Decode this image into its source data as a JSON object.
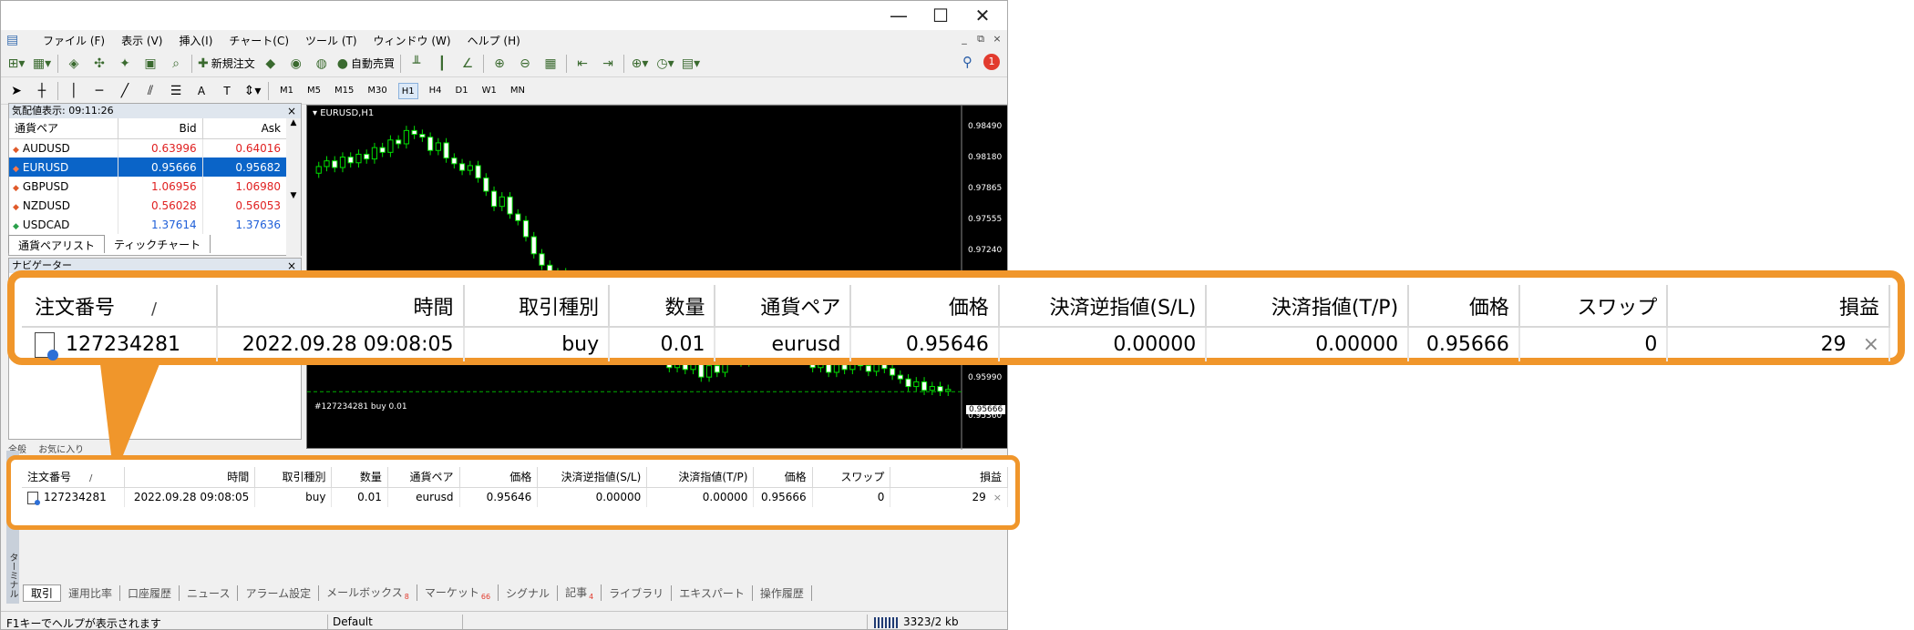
{
  "window": {
    "controls": {
      "minimize": "—",
      "maximize": "☐",
      "close": "✕"
    },
    "mdi_controls": [
      "_",
      "⧉",
      "×"
    ]
  },
  "menu": [
    "ファイル (F)",
    "表示 (V)",
    "挿入(I)",
    "チャート(C)",
    "ツール (T)",
    "ウィンドウ (W)",
    "ヘルプ (H)"
  ],
  "toolbar": {
    "new_order": "新規注文",
    "auto_trading": "自動売買",
    "notification_count": "1"
  },
  "timeframes": [
    "M1",
    "M5",
    "M15",
    "M30",
    "H1",
    "H4",
    "D1",
    "W1",
    "MN"
  ],
  "active_timeframe": "H1",
  "market_watch": {
    "title": "気配値表示: 09:11:26",
    "headers": {
      "symbol": "通貨ペア",
      "bid": "Bid",
      "ask": "Ask"
    },
    "rows": [
      {
        "symbol": "AUDUSD",
        "bid": "0.63996",
        "ask": "0.64016",
        "dir": "down"
      },
      {
        "symbol": "EURUSD",
        "bid": "0.95666",
        "ask": "0.95682",
        "dir": "down",
        "selected": true
      },
      {
        "symbol": "GBPUSD",
        "bid": "1.06956",
        "ask": "1.06980",
        "dir": "down"
      },
      {
        "symbol": "NZDUSD",
        "bid": "0.56028",
        "ask": "0.56053",
        "dir": "down"
      },
      {
        "symbol": "USDCAD",
        "bid": "1.37614",
        "ask": "1.37636",
        "dir": "up"
      }
    ],
    "tabs": [
      "通貨ペアリスト",
      "ティックチャート"
    ]
  },
  "navigator": {
    "title": "ナビゲーター"
  },
  "chart": {
    "title": "EURUSD,H1",
    "price_ticks": [
      "0.98490",
      "0.98180",
      "0.97865",
      "0.97555",
      "0.97240",
      "0.95990",
      "0.95360"
    ],
    "order_line_label": "#127234281 buy 0.01",
    "bid_tag": "0.95666",
    "candles": [
      0.9795,
      0.9802,
      0.9808,
      0.9801,
      0.9812,
      0.9806,
      0.9815,
      0.981,
      0.9822,
      0.9817,
      0.983,
      0.9826,
      0.984,
      0.9836,
      0.9833,
      0.9819,
      0.9827,
      0.9811,
      0.9805,
      0.9798,
      0.9803,
      0.979,
      0.9776,
      0.976,
      0.977,
      0.9752,
      0.9745,
      0.9728,
      0.971,
      0.9698,
      0.9684,
      0.969,
      0.967,
      0.966,
      0.9645,
      0.9655,
      0.9636,
      0.9628,
      0.964,
      0.9622,
      0.9605,
      0.9615,
      0.9598,
      0.961,
      0.9602,
      0.959,
      0.96,
      0.9588,
      0.9595,
      0.958,
      0.9592,
      0.9585,
      0.9598,
      0.9604,
      0.9596,
      0.961,
      0.9602,
      0.9615,
      0.9608,
      0.962,
      0.9611,
      0.9604,
      0.9598,
      0.959,
      0.9596,
      0.9585,
      0.9593,
      0.9588,
      0.96,
      0.9592,
      0.9586,
      0.9597,
      0.9589,
      0.9582,
      0.9578,
      0.957,
      0.9575,
      0.9566,
      0.957,
      0.9565,
      0.9567
    ]
  },
  "terminal": {
    "side_label": "ターミナル",
    "left_tab_labels": [
      "全般",
      "お気に入り"
    ],
    "tabs": [
      {
        "label": "取引",
        "active": true
      },
      {
        "label": "運用比率"
      },
      {
        "label": "口座履歴"
      },
      {
        "label": "ニュース"
      },
      {
        "label": "アラーム設定"
      },
      {
        "label": "メールボックス",
        "badge": "8"
      },
      {
        "label": "マーケット",
        "badge": "66"
      },
      {
        "label": "シグナル"
      },
      {
        "label": "記事",
        "badge": "4"
      },
      {
        "label": "ライブラリ"
      },
      {
        "label": "エキスパート"
      },
      {
        "label": "操作履歴"
      }
    ]
  },
  "trade_table": {
    "headers": [
      "注文番号",
      "時間",
      "取引種別",
      "数量",
      "通貨ペア",
      "価格",
      "決済逆指値(S/L)",
      "決済指値(T/P)",
      "価格",
      "スワップ",
      "損益"
    ],
    "sort_indicator": "/",
    "row": {
      "order": "127234281",
      "time": "2022.09.28 09:08:05",
      "type": "buy",
      "volume": "0.01",
      "symbol": "eurusd",
      "open_price": "0.95646",
      "sl": "0.00000",
      "tp": "0.00000",
      "current_price": "0.95666",
      "swap": "0",
      "profit": "29"
    },
    "close_glyph": "×"
  },
  "statusbar": {
    "help": "F1キーでヘルプが表示されます",
    "profile": "Default",
    "connection": "3323/2 kb"
  },
  "colors": {
    "accent_orange": "#f0962b",
    "selection_blue": "#0a64c8",
    "down_red": "#e02020",
    "up_blue": "#1f5fd8",
    "candle_green": "#00e000"
  }
}
